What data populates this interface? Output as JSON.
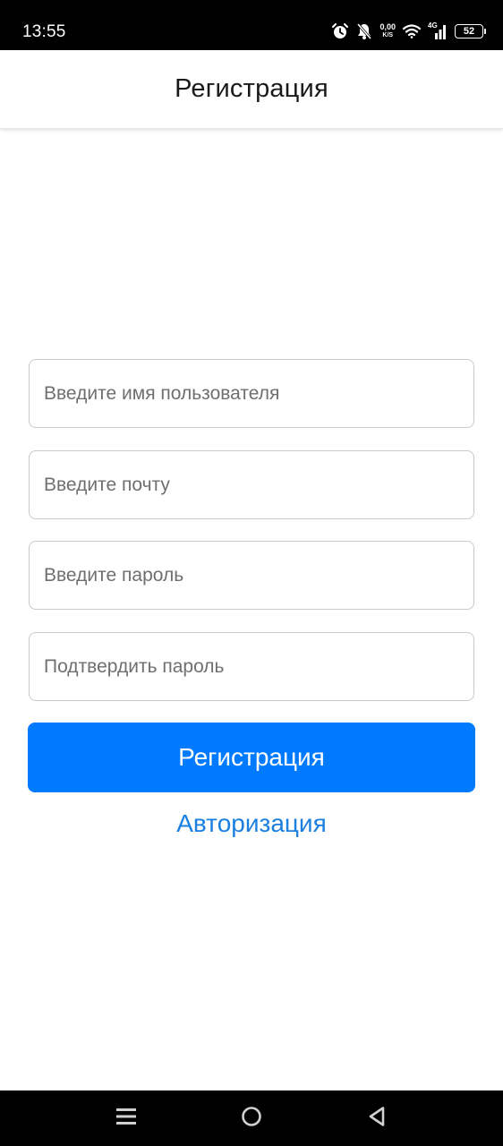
{
  "status_bar": {
    "time": "13:55",
    "net_speed_value": "0,00",
    "net_speed_unit": "K/S",
    "network_type": "4G",
    "battery_level": "52",
    "battery_fraction": 0.52,
    "icons": [
      "alarm-icon",
      "bell-muted-icon",
      "wifi-icon",
      "signal-icon",
      "battery-icon"
    ]
  },
  "header": {
    "title": "Регистрация"
  },
  "form": {
    "username_placeholder": "Введите имя пользователя",
    "email_placeholder": "Введите почту",
    "password_placeholder": "Введите пароль",
    "confirm_placeholder": "Подтвердить пароль",
    "submit_label": "Регистрация",
    "login_link": "Авторизация"
  },
  "nav_bar": {
    "icons": [
      "menu-icon",
      "home-icon",
      "back-icon"
    ]
  },
  "colors": {
    "primary": "#007bff",
    "link": "#1a7fe0",
    "status_bar_bg": "#000000",
    "nav_bar_bg": "#000000"
  }
}
